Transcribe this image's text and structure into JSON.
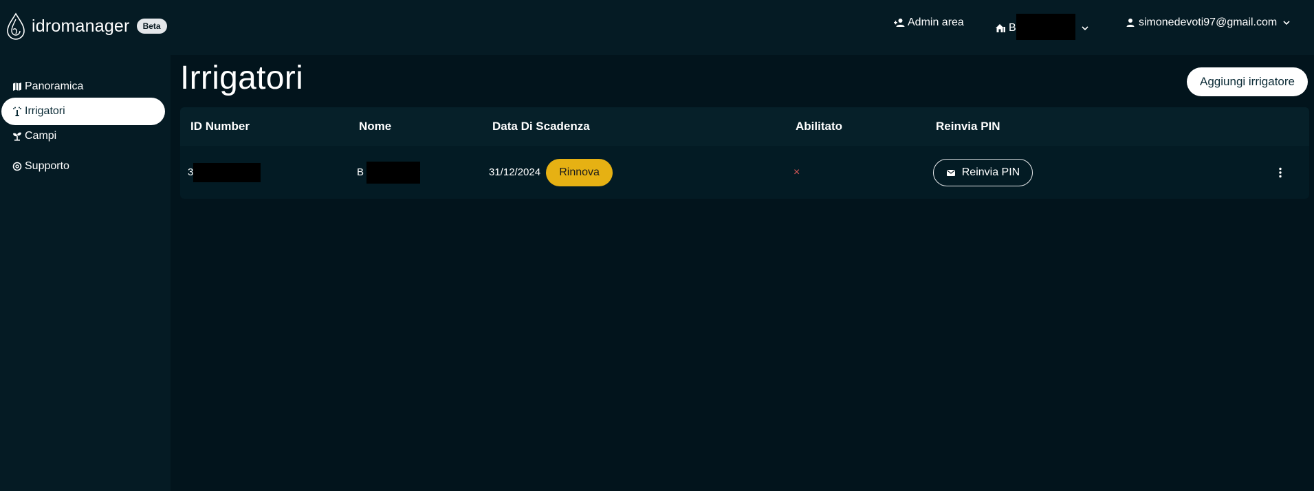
{
  "header": {
    "app_name": "idromanager",
    "badge": "Beta",
    "admin_area": "Admin area",
    "house_label_prefix": "B",
    "user_email": "simonedevoti97@gmail.com"
  },
  "sidebar": {
    "items": [
      {
        "label": "Panoramica",
        "icon": "map-icon",
        "active": false
      },
      {
        "label": "Irrigatori",
        "icon": "sprinkler-icon",
        "active": true
      },
      {
        "label": "Campi",
        "icon": "sprout-icon",
        "active": false
      },
      {
        "label": "Supporto",
        "icon": "support-icon",
        "active": false
      }
    ]
  },
  "main": {
    "title": "Irrigatori",
    "add_button": "Aggiungi irrigatore",
    "table": {
      "columns": [
        "ID Number",
        "Nome",
        "Data Di Scadenza",
        "Abilitato",
        "Reinvia PIN"
      ],
      "rows": [
        {
          "id_prefix": "3",
          "name_prefix": "B",
          "expiry": "31/12/2024",
          "renew_label": "Rinnova",
          "enabled_mark": "×",
          "resend_label": "Reinvia PIN"
        }
      ]
    }
  },
  "colors": {
    "background": "#02141c",
    "panel": "#051b24",
    "accent_yellow": "#e6b113",
    "disabled_red": "#e05a5a"
  }
}
